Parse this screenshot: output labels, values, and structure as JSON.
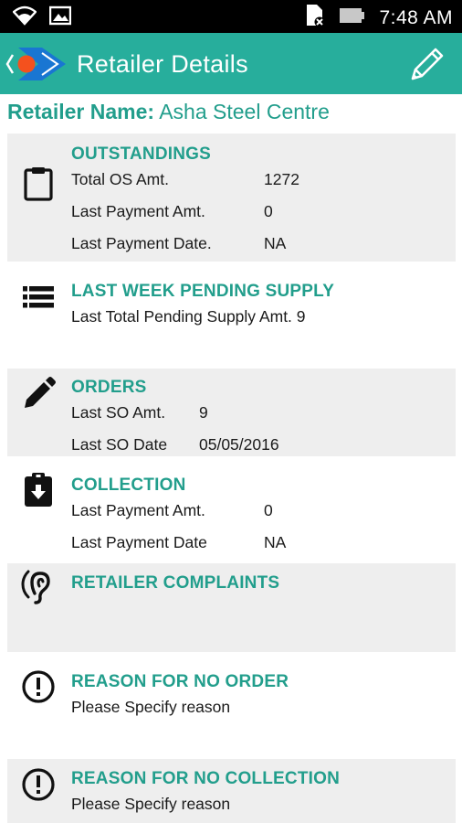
{
  "status_bar": {
    "time": "7:48 AM",
    "icons": [
      "wifi-icon",
      "image-notification-icon",
      "no-sim-icon",
      "battery-icon"
    ]
  },
  "app_bar": {
    "title": "Retailer Details",
    "icons": [
      "back-logo-icon",
      "edit-pencil-icon"
    ],
    "colors": {
      "primary": "#27ae9c",
      "logo_blue": "#1976d2",
      "logo_orange": "#f4511e"
    }
  },
  "retailer": {
    "label": "Retailer Name:",
    "name": "Asha Steel Centre"
  },
  "outstandings": {
    "title": "OUTSTANDINGS",
    "icon": "clipboard-icon",
    "rows": [
      {
        "label": "Total OS Amt.",
        "value": "1272"
      },
      {
        "label": "Last Payment Amt.",
        "value": "0"
      },
      {
        "label": "Last Payment Date.",
        "value": "NA"
      }
    ]
  },
  "pending_supply": {
    "title": "LAST WEEK PENDING SUPPLY",
    "icon": "list-icon",
    "text": "Last Total Pending Supply Amt. 9"
  },
  "orders": {
    "title": "ORDERS",
    "icon": "pencil-icon",
    "rows": [
      {
        "label": "Last SO Amt.",
        "value": "9"
      },
      {
        "label": "Last SO Date",
        "value": "05/05/2016"
      }
    ]
  },
  "collection": {
    "title": "COLLECTION",
    "icon": "clipboard-download-icon",
    "rows": [
      {
        "label": "Last Payment Amt.",
        "value": "0"
      },
      {
        "label": "Last Payment Date",
        "value": "NA"
      }
    ]
  },
  "complaints": {
    "title": "RETAILER COMPLAINTS",
    "icon": "hearing-ear-icon"
  },
  "no_order": {
    "title": "REASON FOR NO ORDER",
    "icon": "alert-circle-icon",
    "placeholder": "Please Specify reason"
  },
  "no_collection": {
    "title": "REASON FOR NO COLLECTION",
    "icon": "alert-circle-icon",
    "placeholder": "Please Specify reason"
  }
}
